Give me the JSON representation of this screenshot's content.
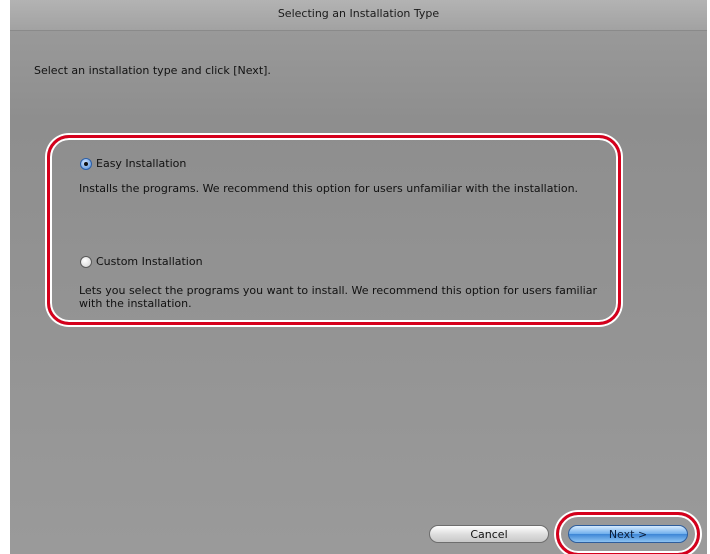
{
  "window": {
    "title": "Selecting an Installation Type"
  },
  "instruction": "Select an installation type and click [Next].",
  "options": [
    {
      "label": "Easy Installation",
      "description": "Installs the programs. We recommend this option for users unfamiliar with the installation.",
      "selected": true
    },
    {
      "label": "Custom Installation",
      "description": "Lets you select the programs you want to install. We recommend this option for users familiar with the installation.",
      "selected": false
    }
  ],
  "buttons": {
    "cancel": "Cancel",
    "next": "Next >"
  },
  "colors": {
    "highlight": "#d5001c",
    "window_bg": "#9a9a9a",
    "selected_radio": "#4c8ad8"
  }
}
